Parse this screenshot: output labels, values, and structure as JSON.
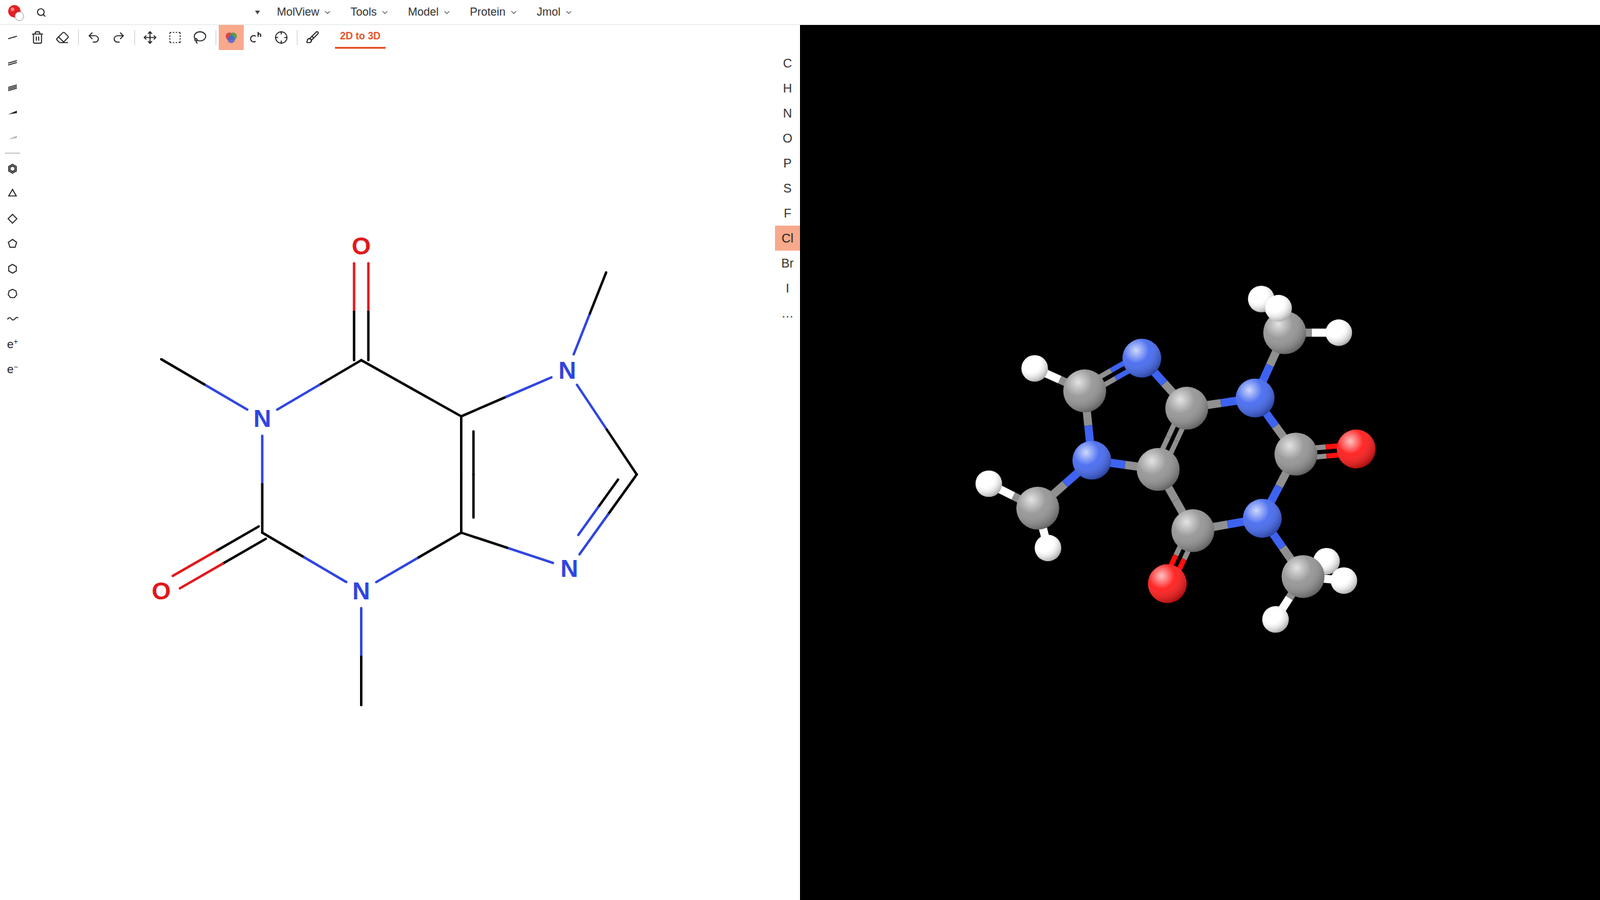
{
  "menubar": {
    "menus": [
      "MolView",
      "Tools",
      "Model",
      "Protein",
      "Jmol"
    ]
  },
  "toolbar": {
    "tools": [
      {
        "kind": "trash",
        "selected": false
      },
      {
        "kind": "eraser",
        "selected": false
      },
      {
        "kind": "undo",
        "selected": false
      },
      {
        "kind": "redo",
        "selected": false
      },
      {
        "kind": "move",
        "selected": false
      },
      {
        "kind": "rect-select",
        "selected": false
      },
      {
        "kind": "lasso",
        "selected": false
      },
      {
        "kind": "color",
        "selected": true
      },
      {
        "kind": "hydrogen",
        "selected": false
      },
      {
        "kind": "center",
        "selected": false
      },
      {
        "kind": "clean",
        "selected": false
      }
    ],
    "convert_button": "2D to 3D"
  },
  "draw_tools": [
    {
      "kind": "bond-single"
    },
    {
      "kind": "bond-double"
    },
    {
      "kind": "bond-triple"
    },
    {
      "kind": "bond-wedge"
    },
    {
      "kind": "bond-hash"
    },
    {
      "kind": "ring-benzene"
    },
    {
      "kind": "ring-3"
    },
    {
      "kind": "ring-4"
    },
    {
      "kind": "ring-5"
    },
    {
      "kind": "ring-6"
    },
    {
      "kind": "ring-7"
    },
    {
      "kind": "chain"
    },
    {
      "kind": "charge",
      "label": "e",
      "sup": "+"
    },
    {
      "kind": "charge",
      "label": "e",
      "sup": "−"
    }
  ],
  "elements": [
    {
      "label": "C",
      "selected": false
    },
    {
      "label": "H",
      "selected": false
    },
    {
      "label": "N",
      "selected": false
    },
    {
      "label": "O",
      "selected": false
    },
    {
      "label": "P",
      "selected": false
    },
    {
      "label": "S",
      "selected": false
    },
    {
      "label": "F",
      "selected": false
    },
    {
      "label": "Cl",
      "selected": true
    },
    {
      "label": "Br",
      "selected": false
    },
    {
      "label": "I",
      "selected": false
    },
    {
      "label": "…",
      "selected": false
    }
  ],
  "sketch": {
    "atoms": [
      {
        "label": "O",
        "color": "#e0181b"
      },
      {
        "label": "N",
        "color": "#2f45e0"
      },
      {
        "label": "N",
        "color": "#2f45e0"
      },
      {
        "label": "N",
        "color": "#2f45e0"
      },
      {
        "label": "O",
        "color": "#e0181b"
      },
      {
        "label": "N",
        "color": "#2f45e0"
      }
    ]
  },
  "model3d": {
    "element_colors": {
      "C": "#909090",
      "H": "#ffffff",
      "N": "#3d63f0",
      "O": "#ff1010"
    }
  }
}
